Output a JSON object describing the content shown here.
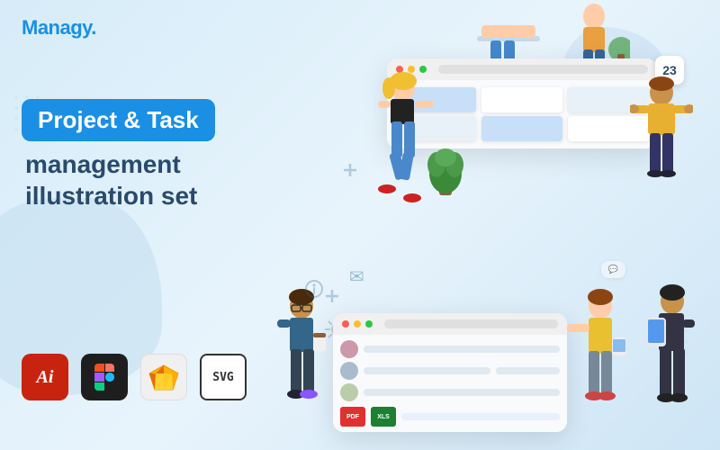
{
  "brand": {
    "logo": "Managy."
  },
  "hero": {
    "badge_text": "Project & Task",
    "subtitle_line1": "management",
    "subtitle_line2": "illustration set"
  },
  "tools": {
    "ai_label": "Ai",
    "figma_label": "Figma",
    "sketch_label": "Sketch",
    "svg_label": "SVG"
  },
  "calendar": {
    "date": "23"
  },
  "colors": {
    "brand_blue": "#1a8fe3",
    "dark_navy": "#2a4a6b",
    "bg_light": "#ddeef8"
  },
  "decorations": {
    "plant_emoji": "🌿",
    "envelope": "✉",
    "chat": "💬"
  }
}
